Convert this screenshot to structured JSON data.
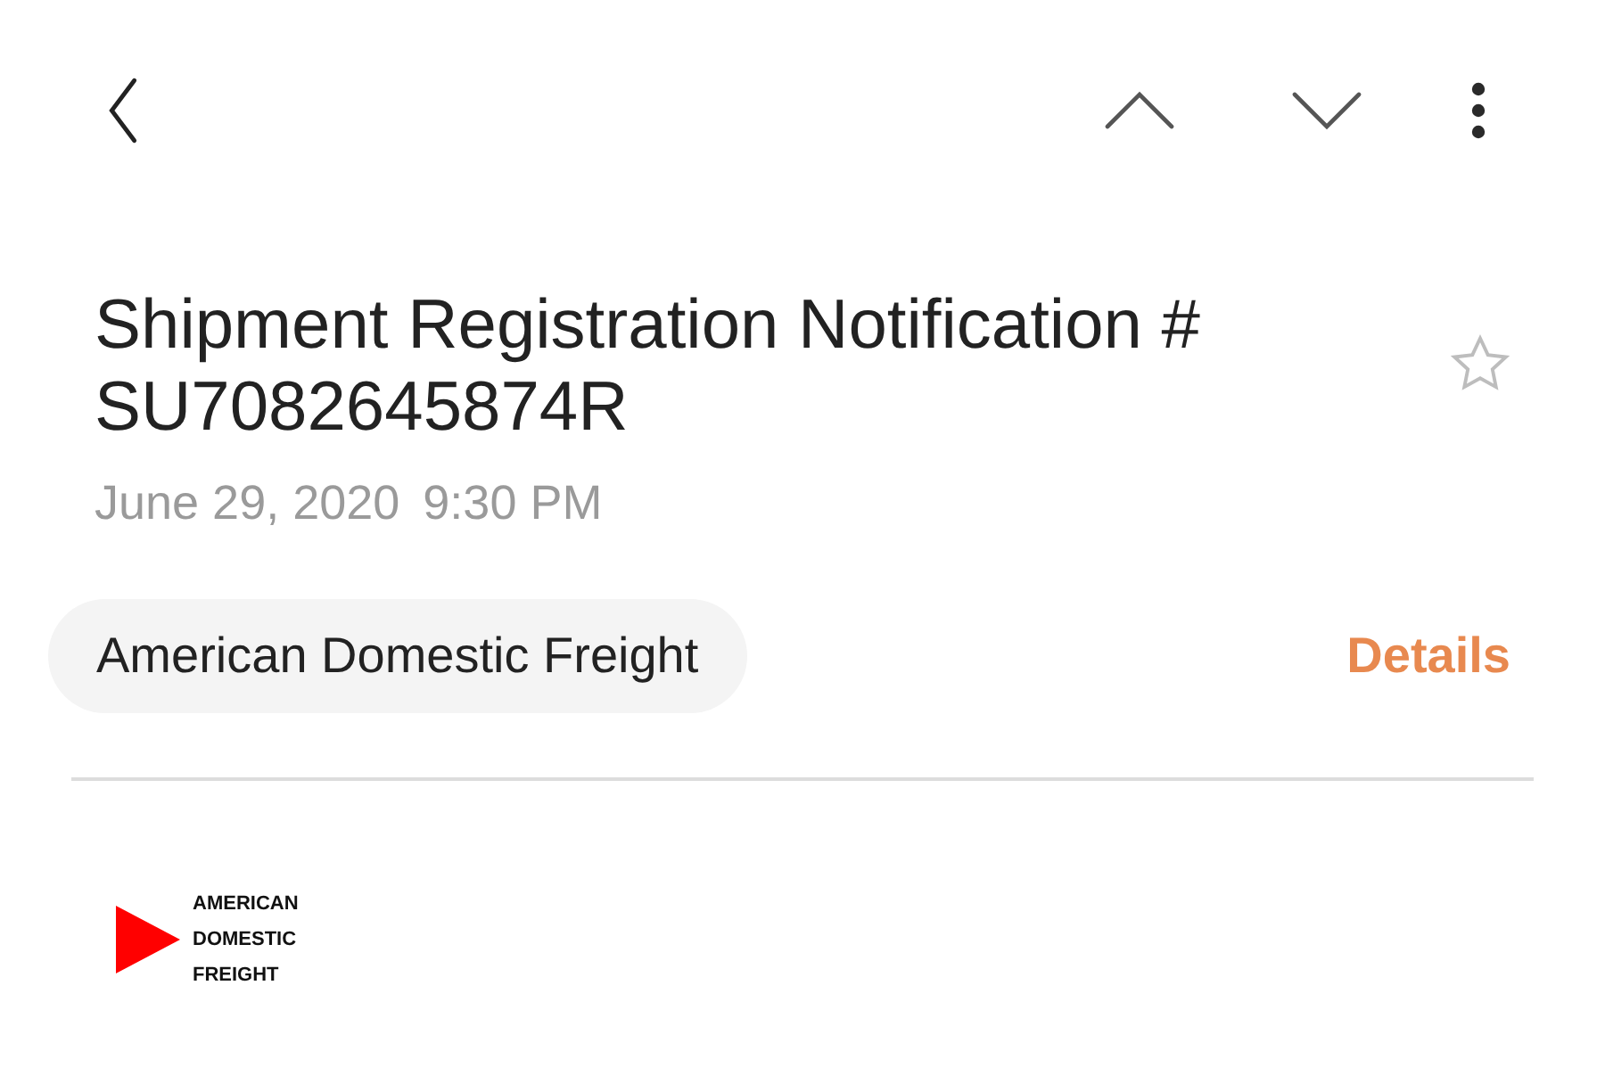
{
  "message": {
    "subject": "Shipment Registration Notification # SU7082645874R",
    "starred": false,
    "date": "June 29, 2020",
    "time": "9:30 PM"
  },
  "sender": {
    "name": "American Domestic Freight",
    "details": "Details"
  },
  "body": {
    "logo_lines": [
      "AMERICAN",
      "DOMESTIC",
      "FREIGHT"
    ]
  }
}
